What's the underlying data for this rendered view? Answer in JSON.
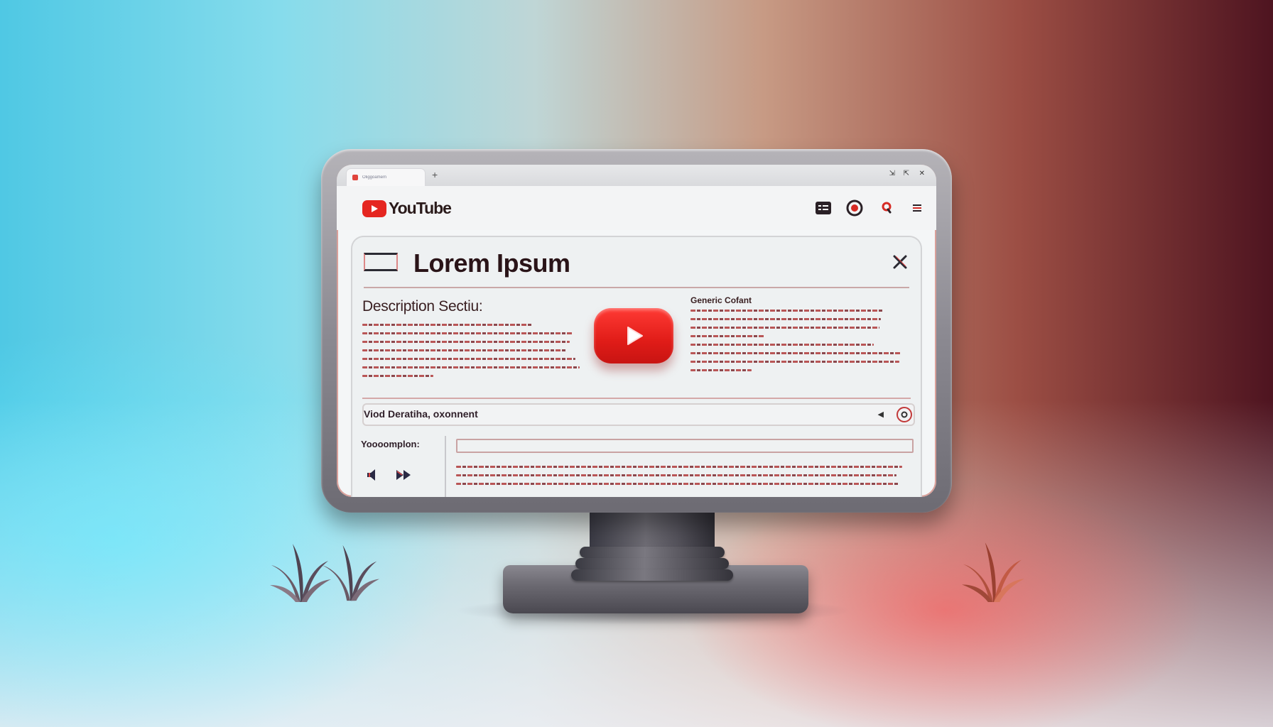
{
  "browser": {
    "tab_title": "Oliggoamem",
    "new_tab": "+",
    "controls": [
      "⇲",
      "⇱",
      "✕"
    ]
  },
  "youtube": {
    "logo_text": "YouTube",
    "header_icons": [
      "playlist-icon",
      "record-icon",
      "search-icon",
      "menu-icon"
    ]
  },
  "card": {
    "title": "Lorem Ipsum",
    "description_heading": "Description Sectiu:",
    "generic_heading": "Generic Cofant",
    "details_label": "Viod Deratiha, oxonnent",
    "sidebar_title": "Yoooomplon:"
  },
  "colors": {
    "youtube_red": "#e52620",
    "text_dark": "#2a1418",
    "divider": "#d4a9a9"
  }
}
